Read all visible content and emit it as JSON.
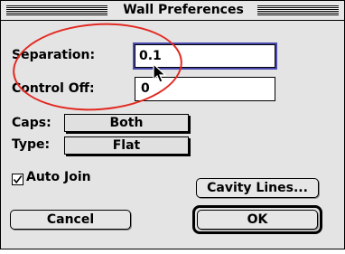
{
  "window": {
    "title": "Wall Preferences"
  },
  "fields": {
    "separation_label": "Separation:",
    "separation_value": "0.1",
    "control_off_label": "Control Off:",
    "control_off_value": "0"
  },
  "options": {
    "caps_label": "Caps:",
    "caps_value": "Both",
    "type_label": "Type:",
    "type_value": "Flat",
    "auto_join_label": "Auto Join",
    "auto_join_checked": true
  },
  "buttons": {
    "cavity_lines": "Cavity Lines...",
    "cancel": "Cancel",
    "ok": "OK"
  },
  "annotation": {
    "color": "#e22a22"
  }
}
